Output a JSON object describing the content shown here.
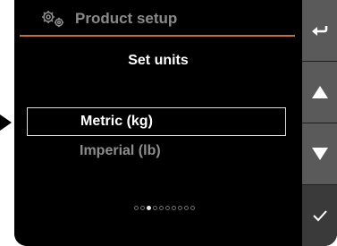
{
  "header": {
    "icon": "gears-icon",
    "title": "Product setup"
  },
  "subtitle": "Set units",
  "options": [
    {
      "label": "Metric (kg)",
      "selected": true
    },
    {
      "label": "Imperial (lb)",
      "selected": false
    }
  ],
  "pager": {
    "total": 10,
    "current": 3
  },
  "keys": [
    {
      "icon": "back-arrow-icon"
    },
    {
      "icon": "up-triangle-icon"
    },
    {
      "icon": "down-triangle-icon"
    },
    {
      "icon": "check-icon"
    }
  ],
  "colors": {
    "accent": "#c2702d",
    "screen": "#000000",
    "key": "#5a5a5a"
  }
}
